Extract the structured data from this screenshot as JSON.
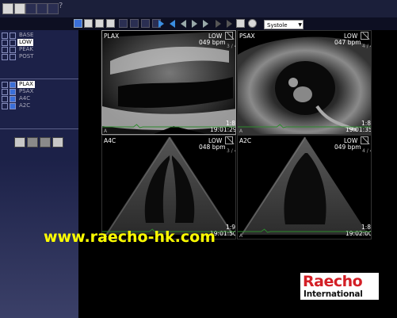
{
  "toolbar": {
    "cardiac_phase": "Systole"
  },
  "sidebar": {
    "stages": [
      {
        "label": "BASE",
        "selected": false
      },
      {
        "label": "LOW",
        "selected": true
      },
      {
        "label": "PEAK",
        "selected": false
      },
      {
        "label": "POST",
        "selected": false
      }
    ],
    "views": [
      {
        "label": "PLAX",
        "selected": true
      },
      {
        "label": "PSAX",
        "selected": false
      },
      {
        "label": "A4C",
        "selected": false
      },
      {
        "label": "A2C",
        "selected": false
      }
    ]
  },
  "panels": [
    {
      "view": "PLAX",
      "stage": "LOW",
      "bpm": "049 bpm",
      "frame": "3 / 4",
      "time": "19:01:29",
      "ratio": "1:8",
      "ecg_label": "A"
    },
    {
      "view": "PSAX",
      "stage": "LOW",
      "bpm": "047 bpm",
      "frame": "4 / 4",
      "time": "19:01:35",
      "ratio": "1:8",
      "ecg_label": "A"
    },
    {
      "view": "A4C",
      "stage": "LOW",
      "bpm": "048 bpm",
      "frame": "3 / 4",
      "time": "19:01:50",
      "ratio": "1:9",
      "ecg_label": "A"
    },
    {
      "view": "A2C",
      "stage": "LOW",
      "bpm": "049 bpm",
      "frame": "4 / 4",
      "time": "19:02:00",
      "ratio": "1:8",
      "ecg_label": "A"
    }
  ],
  "watermark": "www.raecho-hk.com",
  "logo": {
    "line1": "Raecho",
    "line2": "International"
  },
  "colors": {
    "watermark": "#ffff00",
    "logo_red": "#d31f26",
    "sidebar": "#1c2148"
  }
}
